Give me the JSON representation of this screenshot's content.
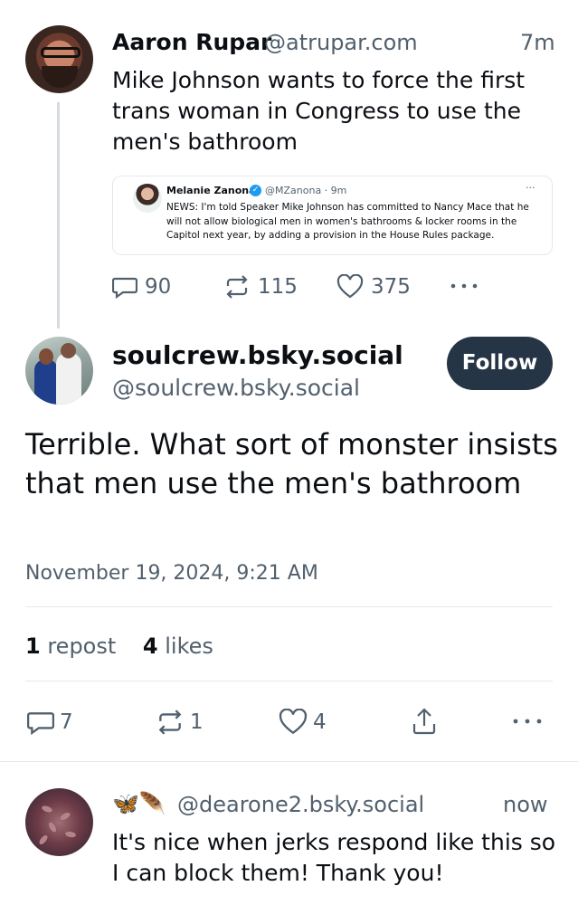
{
  "post1": {
    "name": "Aaron Rupar",
    "handle": "@atrupar.com",
    "time": "7m",
    "text": "Mike Johnson wants to force the first trans woman in Congress to use the men's bathroom",
    "embed": {
      "name": "Melanie Zanona",
      "handle": "@MZanona · 9m",
      "text": "NEWS: I'm told Speaker Mike Johnson has committed to Nancy Mace that he will not allow biological men in women's bathrooms & locker rooms in the Capitol next year, by adding a provision in the House Rules package."
    },
    "actions": {
      "replies": "90",
      "reposts": "115",
      "likes": "375"
    }
  },
  "post2": {
    "name": "soulcrew.bsky.social",
    "handle": "@soulcrew.bsky.social",
    "follow_label": "Follow",
    "text": "Terrible. What sort of monster insists that men use the men's bathroom",
    "date": "November 19, 2024, 9:21 AM",
    "reposts_count": "1",
    "reposts_label": "repost",
    "likes_count": "4",
    "likes_label": "likes",
    "actions": {
      "replies": "7",
      "reposts": "1",
      "likes": "4"
    }
  },
  "post3": {
    "emoji": "🦋🪶",
    "handle": "@dearone2.bsky.social",
    "time": "now",
    "text": "It's nice when jerks respond like this so I can block them! Thank you!"
  },
  "colors": {
    "text": "#0b0f14",
    "muted": "#52606e",
    "follow_button": "#253545",
    "divider": "#e3e8ed"
  },
  "icons": [
    "reply-icon",
    "repost-icon",
    "like-icon",
    "more-icon",
    "share-icon",
    "verified-icon"
  ]
}
